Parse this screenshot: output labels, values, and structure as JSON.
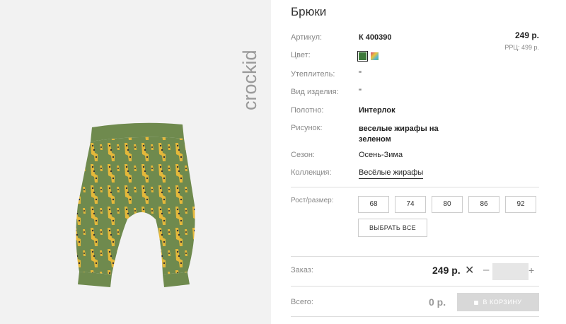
{
  "product": {
    "title": "Брюки",
    "brand_logo": "crockid",
    "image_icon": "pants-giraffe-print-image"
  },
  "details": [
    {
      "label": "Артикул:",
      "value": "К 400390"
    },
    {
      "label": "Цвет:",
      "value": ""
    },
    {
      "label": "Утеплитель:",
      "value": "\""
    },
    {
      "label": "Вид изделия:",
      "value": "\""
    },
    {
      "label": "Полотно:",
      "value": "Интерлок"
    },
    {
      "label": "Рисунок:",
      "value": "веселые жирафы на зеленом"
    },
    {
      "label": "Сезон:",
      "value": "Осень-Зима"
    },
    {
      "label": "Коллекция:",
      "value": "Весёлые жирафы"
    }
  ],
  "pricing": {
    "price": "249 р.",
    "rrc": "РРЦ: 499 р."
  },
  "colors": {
    "swatch_selected": "#3f7a3b",
    "swatch_multicolor": "multicolor"
  },
  "sizes": {
    "label": "Рост/размер:",
    "options": [
      "68",
      "74",
      "80",
      "86",
      "92"
    ],
    "select_all": "ВЫБРАТЬ ВСЕ"
  },
  "order": {
    "label": "Заказ:",
    "price": "249 р.",
    "remove_icon": "close-icon",
    "minus": "–",
    "plus": "+",
    "quantity": ""
  },
  "total": {
    "label": "Всего:",
    "value": "0 р.",
    "cart_button": "В КОРЗИНУ"
  }
}
